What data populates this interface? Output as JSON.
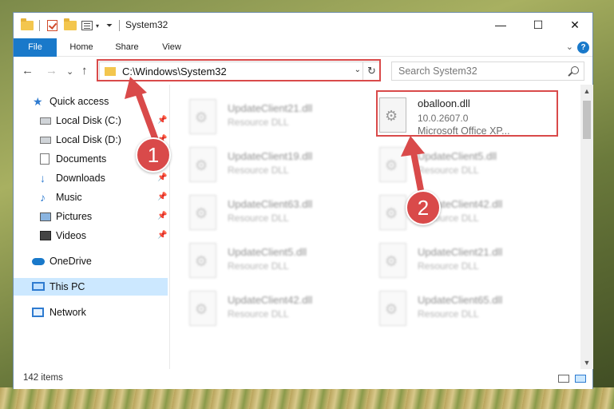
{
  "window": {
    "title": "System32",
    "minimize_icon": "minimize-icon",
    "maximize_icon": "maximize-icon",
    "close_icon": "close-icon",
    "minimize_glyph": "—",
    "maximize_glyph": "☐",
    "close_glyph": "✕"
  },
  "ribbon": {
    "tabs": [
      "File",
      "Home",
      "Share",
      "View"
    ],
    "expand_glyph": "⌄",
    "help_glyph": "?"
  },
  "address": {
    "path": "C:\\Windows\\System32",
    "dropdown_glyph": "⌄",
    "refresh_glyph": "↻",
    "back_glyph": "←",
    "forward_glyph": "→",
    "recent_glyph": "⌄",
    "up_glyph": "↑"
  },
  "search": {
    "placeholder": "Search System32"
  },
  "nav": {
    "items": [
      {
        "label": "Quick access",
        "icon": "star-icon",
        "pinned": false
      },
      {
        "label": "Local Disk (C:)",
        "icon": "disk-icon",
        "pinned": true
      },
      {
        "label": "Local Disk (D:)",
        "icon": "disk-icon",
        "pinned": true
      },
      {
        "label": "Documents",
        "icon": "document-icon",
        "pinned": true
      },
      {
        "label": "Downloads",
        "icon": "download-icon",
        "pinned": true
      },
      {
        "label": "Music",
        "icon": "music-icon",
        "pinned": true
      },
      {
        "label": "Pictures",
        "icon": "pictures-icon",
        "pinned": true
      },
      {
        "label": "Videos",
        "icon": "videos-icon",
        "pinned": true
      },
      {
        "label": "OneDrive",
        "icon": "cloud-icon",
        "pinned": false
      },
      {
        "label": "This PC",
        "icon": "pc-icon",
        "pinned": false,
        "selected": true
      },
      {
        "label": "Network",
        "icon": "network-icon",
        "pinned": false
      }
    ],
    "pin_glyph": "📌"
  },
  "files": {
    "highlighted": {
      "name": "oballoon.dll",
      "version": "10.0.2607.0",
      "description": "Microsoft Office XP..."
    },
    "blurred_left": [
      {
        "name": "UpdateClient21.dll",
        "type": "Resource DLL"
      },
      {
        "name": "UpdateClient19.dll",
        "type": "Resource DLL"
      },
      {
        "name": "UpdateClient63.dll",
        "type": "Resource DLL"
      },
      {
        "name": "UpdateClient5.dll",
        "type": "Resource DLL"
      },
      {
        "name": "UpdateClient42.dll",
        "type": "Resource DLL"
      }
    ],
    "blurred_right": [
      {
        "name": "UpdateClient5.dll",
        "type": "Resource DLL"
      },
      {
        "name": "UpdateClient42.dll",
        "type": "Resource DLL"
      },
      {
        "name": "UpdateClient21.dll",
        "type": "Resource DLL"
      },
      {
        "name": "UpdateClient65.dll",
        "type": "Resource DLL"
      }
    ]
  },
  "scrollbar": {
    "up_glyph": "▲",
    "down_glyph": "▼"
  },
  "status": {
    "item_count": "142 items"
  },
  "annotations": {
    "step1": "1",
    "step2": "2",
    "color": "#d94a4a"
  }
}
